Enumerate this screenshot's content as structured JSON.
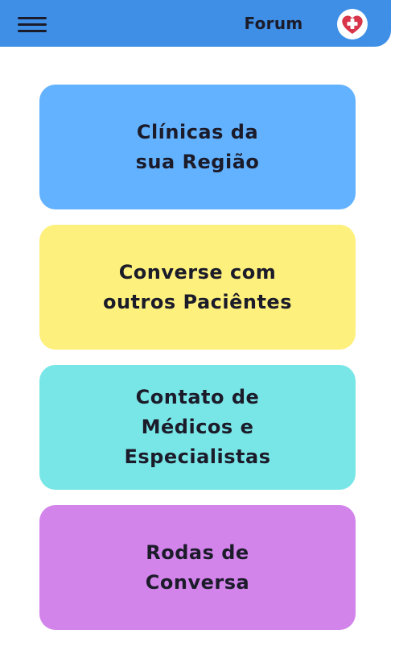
{
  "header": {
    "title": "Forum",
    "menu_icon": "hamburger-menu-icon",
    "logo_icon": "heart-medical-cross-icon",
    "bar_color": "#3f8fe6"
  },
  "cards": [
    {
      "label": "Clínicas da\nsua Região",
      "color": "#63b2ff"
    },
    {
      "label": "Converse com\noutros Paciêntes",
      "color": "#fdf07d"
    },
    {
      "label": "Contato de\nMédicos e\nEspecialistas",
      "color": "#78e6e6"
    },
    {
      "label": "Rodas de\nConversa",
      "color": "#d284ea"
    }
  ]
}
